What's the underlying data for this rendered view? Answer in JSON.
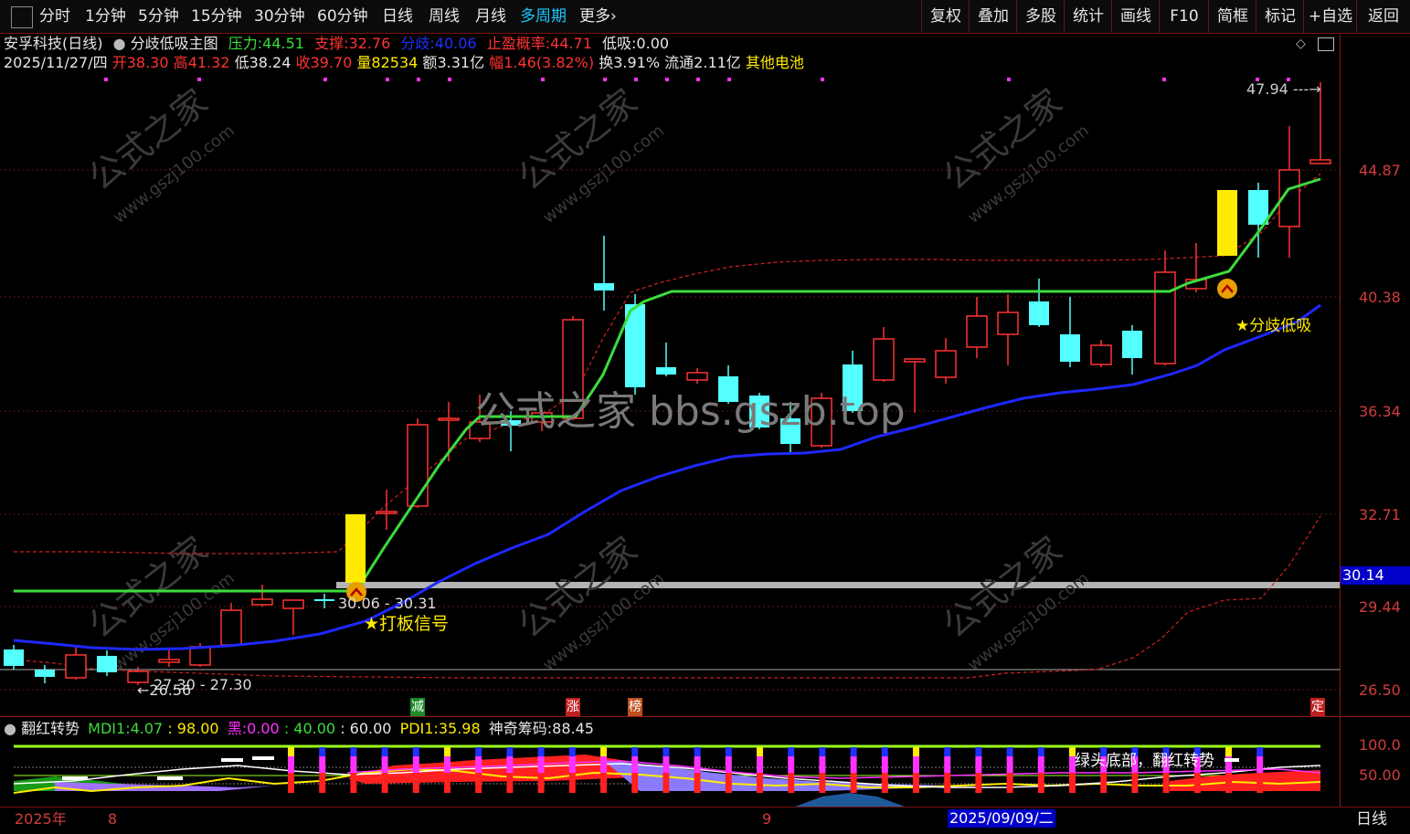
{
  "toolbar": {
    "left_items": [
      "分时",
      "1分钟",
      "5分钟",
      "15分钟",
      "30分钟",
      "60分钟",
      "日线",
      "周线",
      "月线",
      "多周期",
      "更多"
    ],
    "more_arrow": "›",
    "right_items": [
      "复权",
      "叠加",
      "多股",
      "统计",
      "画线",
      "F10",
      "简框",
      "标记",
      "+自选",
      "返回"
    ]
  },
  "info": {
    "stock_title": "安孚科技(日线)",
    "indicator_name": "分歧低吸主图",
    "pressure_label": "压力:",
    "pressure_value": "44.51",
    "support_label": "支撑:",
    "support_value": "32.76",
    "diverge_label": "分歧:",
    "diverge_value": "40.06",
    "tp_label": "止盈概率:",
    "tp_value": "44.71",
    "lowbuy_label": "低吸:",
    "lowbuy_value": "0.00",
    "date": "2025/11/27/四",
    "open_label": "开",
    "open": "38.30",
    "high_label": "高",
    "high": "41.32",
    "low_label": "低",
    "low": "38.24",
    "close_label": "收",
    "close": "39.70",
    "vol_label": "量",
    "vol": "82534",
    "amount_label": "额",
    "amount": "3.31亿",
    "range_label": "幅",
    "range": "1.46(3.82%)",
    "turnover_label": "换",
    "turnover": "3.91%",
    "float_label": "流通",
    "float": "2.11亿",
    "sector": "其他电池"
  },
  "price_axis": {
    "labels": [
      "44.87",
      "40.38",
      "36.34",
      "32.71",
      "29.44",
      "26.50"
    ],
    "current": "30.14"
  },
  "annotations": {
    "high_mark": "47.94",
    "range_a": "30.06 - 30.31",
    "range_b": "27.30 - 27.30",
    "low_mark": "26.56",
    "star_left": "★打板信号",
    "star_right": "★分歧低吸",
    "watermark": "公式之家 bbs.gszb.top",
    "wm_main": "公式之家",
    "wm_url": "www.gszj100.com"
  },
  "markers": [
    {
      "text": "减",
      "color": "#1a8a2a"
    },
    {
      "text": "涨",
      "color": "#c02020"
    },
    {
      "text": "榜",
      "color": "#c05020"
    },
    {
      "text": "定",
      "color": "#c02020"
    }
  ],
  "sub": {
    "title": "翻红转势",
    "mdi_label": "MDI1:",
    "mdi_value": "4.07",
    "v98": ": 98.00",
    "black_label": "黑:",
    "black_value": "0.00",
    "v40": ": 40.00",
    "v60": ": 60.00",
    "pdi_label": "PDI1:",
    "pdi_value": "35.98",
    "chip_label": "神奇筹码:",
    "chip_value": "88.45",
    "note": "绿头底部，翻红转势",
    "axis": [
      "100.0",
      "50.00"
    ]
  },
  "time_axis": {
    "year": "2025年",
    "aug": "8",
    "sep": "9",
    "cursor_date": "2025/09/09/二",
    "period": "日线"
  },
  "colors": {
    "up": "#ff3232",
    "down": "#54ffff",
    "accent_green": "#3cdc3c",
    "blue_line": "#1e28ff",
    "yellow": "#ffff00",
    "magenta": "#ff32ff"
  }
}
